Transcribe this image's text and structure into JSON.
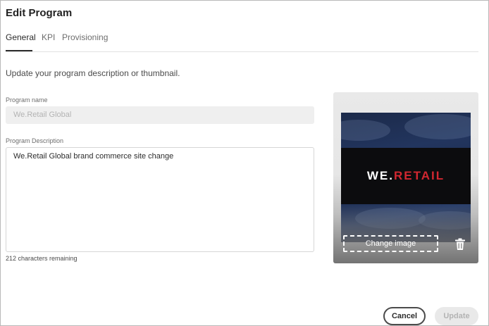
{
  "dialog": {
    "title": "Edit Program"
  },
  "tabs": [
    {
      "label": "General",
      "active": true
    },
    {
      "label": "KPI",
      "active": false
    },
    {
      "label": "Provisioning",
      "active": false
    }
  ],
  "form": {
    "intro": "Update your program description or thumbnail.",
    "program_name_label": "Program name",
    "program_name_value": "We.Retail Global",
    "description_label": "Program Description",
    "description_value": "We.Retail Global brand commerce site change",
    "chars_remaining": "212 characters remaining"
  },
  "thumbnail": {
    "logo_main": "WE.",
    "logo_accent": "RETAIL",
    "change_image_label": "Change image",
    "delete_icon": "trash-icon",
    "accent_color": "#d22730"
  },
  "footer": {
    "cancel_label": "Cancel",
    "update_label": "Update"
  }
}
